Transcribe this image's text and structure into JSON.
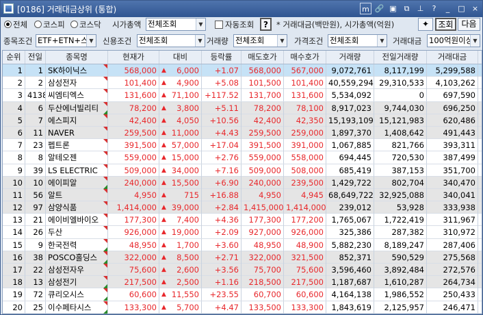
{
  "window": {
    "title": "[0186] 거래대금상위 (통합)"
  },
  "titlebar_buttons": [
    "m",
    "link",
    "box",
    "copy",
    "pin",
    "?",
    "_",
    "□",
    "×"
  ],
  "filters": {
    "market_options": [
      "전체",
      "코스피",
      "코스닥"
    ],
    "market_selected": "전체",
    "market_cap_label": "시가총액",
    "market_cap_value": "전체조회",
    "auto_label": "자동조회",
    "help_label": "?",
    "note": "* 거래대금(백만원), 시가총액(억원)",
    "search_label": "조회",
    "next_label": "다음",
    "stock_cond_label": "종목조건",
    "stock_cond_value": "ETF+ETN+스팩",
    "credit_cond_label": "신용조건",
    "credit_cond_value": "전체조회",
    "volume_label": "거래량",
    "volume_value": "전체조회",
    "price_cond_label": "가격조건",
    "price_cond_value": "전체조회",
    "amount_label": "거래대금",
    "amount_value": "100억원이상"
  },
  "table": {
    "headers": [
      "순위",
      "전일",
      "종목명",
      "현재가",
      "대비",
      "등락률",
      "매도호가",
      "매수호가",
      "거래량",
      "전일거래량",
      "거래대금"
    ],
    "rows": [
      [
        "1",
        "1",
        "SK하이닉스",
        "568,000",
        "6,000",
        "+1.07",
        "568,000",
        "567,000",
        "9,072,761",
        "8,117,199",
        "5,299,588"
      ],
      [
        "2",
        "2",
        "삼성전자",
        "101,400",
        "4,900",
        "+5.08",
        "101,500",
        "101,400",
        "40,559,294",
        "29,310,533",
        "4,103,262"
      ],
      [
        "3",
        "4138",
        "씨엠티엑스",
        "131,600",
        "71,100",
        "+117.52",
        "131,700",
        "131,600",
        "5,534,092",
        "0",
        "697,590"
      ],
      [
        "4",
        "6",
        "두산에너빌리티",
        "78,200",
        "3,800",
        "+5.11",
        "78,200",
        "78,100",
        "8,917,023",
        "9,744,030",
        "696,250"
      ],
      [
        "5",
        "7",
        "에스피지",
        "42,400",
        "4,050",
        "+10.56",
        "42,400",
        "42,350",
        "15,193,109",
        "15,121,983",
        "620,486"
      ],
      [
        "6",
        "11",
        "NAVER",
        "259,500",
        "11,000",
        "+4.43",
        "259,500",
        "259,000",
        "1,897,370",
        "1,408,642",
        "491,443"
      ],
      [
        "7",
        "23",
        "펩트론",
        "391,500",
        "57,000",
        "+17.04",
        "391,500",
        "391,000",
        "1,067,885",
        "821,766",
        "393,311"
      ],
      [
        "8",
        "8",
        "알테오젠",
        "559,000",
        "15,000",
        "+2.76",
        "559,000",
        "558,000",
        "694,445",
        "720,530",
        "387,499"
      ],
      [
        "9",
        "39",
        "LS ELECTRIC",
        "509,000",
        "34,000",
        "+7.16",
        "509,000",
        "508,000",
        "685,419",
        "387,153",
        "351,700"
      ],
      [
        "10",
        "10",
        "에이피알",
        "240,000",
        "15,500",
        "+6.90",
        "240,000",
        "239,500",
        "1,429,722",
        "802,704",
        "340,470"
      ],
      [
        "11",
        "56",
        "알트",
        "4,950",
        "715",
        "+16.88",
        "4,950",
        "4,945",
        "68,649,722",
        "32,925,088",
        "340,041"
      ],
      [
        "12",
        "97",
        "삼양식품",
        "1,414,000",
        "39,000",
        "+2.84",
        "1,415,000",
        "1,414,000",
        "239,012",
        "53,928",
        "333,938"
      ],
      [
        "13",
        "21",
        "에이비엘바이오",
        "177,300",
        "7,400",
        "+4.36",
        "177,300",
        "177,200",
        "1,765,067",
        "1,722,419",
        "311,967"
      ],
      [
        "14",
        "26",
        "두산",
        "926,000",
        "19,000",
        "+2.09",
        "927,000",
        "926,000",
        "325,386",
        "287,382",
        "310,972"
      ],
      [
        "15",
        "9",
        "한국전력",
        "48,950",
        "1,700",
        "+3.60",
        "48,950",
        "48,900",
        "5,882,230",
        "8,189,247",
        "287,406"
      ],
      [
        "16",
        "38",
        "POSCO홀딩스",
        "322,000",
        "8,500",
        "+2.71",
        "322,000",
        "321,500",
        "852,371",
        "590,529",
        "275,568"
      ],
      [
        "17",
        "22",
        "삼성전자우",
        "75,600",
        "2,600",
        "+3.56",
        "75,700",
        "75,600",
        "3,596,460",
        "3,892,484",
        "272,576"
      ],
      [
        "18",
        "13",
        "삼성전기",
        "217,500",
        "2,500",
        "+1.16",
        "218,500",
        "217,500",
        "1,187,687",
        "1,610,287",
        "264,734"
      ],
      [
        "19",
        "72",
        "큐리오시스",
        "60,600",
        "11,550",
        "+23.55",
        "60,700",
        "60,600",
        "4,164,138",
        "1,986,552",
        "250,433"
      ],
      [
        "20",
        "25",
        "이수페타시스",
        "133,300",
        "5,700",
        "+4.47",
        "133,500",
        "133,300",
        "1,843,619",
        "2,125,957",
        "246,471"
      ]
    ]
  }
}
